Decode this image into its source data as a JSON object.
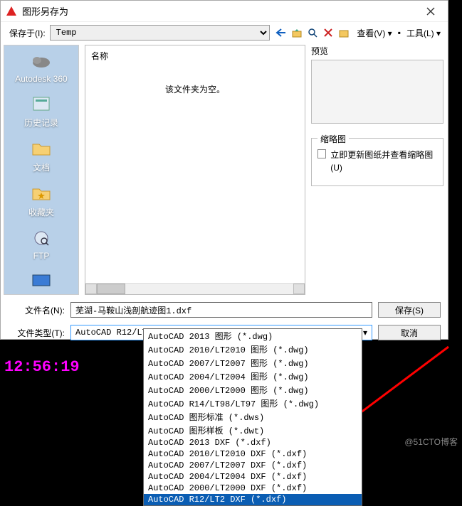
{
  "dialog": {
    "title": "图形另存为"
  },
  "toolbar": {
    "save_in_label": "保存于(I):",
    "folder": "Temp",
    "view_menu": "查看(V)",
    "tools_menu": "工具(L)",
    "separator": "▾",
    "dot": "▪"
  },
  "sidebar": {
    "items": [
      {
        "label": "Autodesk 360"
      },
      {
        "label": "历史记录"
      },
      {
        "label": "文档"
      },
      {
        "label": "收藏夹"
      },
      {
        "label": "FTP"
      },
      {
        "label": "桌面"
      }
    ]
  },
  "file_list": {
    "header": "名称",
    "empty_text": "该文件夹为空。"
  },
  "preview": {
    "label": "预览"
  },
  "thumbnail": {
    "group_label": "缩略图",
    "checkbox_label": "立即更新图纸并查看缩略图(U)"
  },
  "form": {
    "filename_label": "文件名(N):",
    "filename_value": "芜湖-马鞍山浅剖航迹图1.dxf",
    "filetype_label": "文件类型(T):",
    "filetype_value": "AutoCAD R12/LT2 DXF (*.dxf)",
    "save_button": "保存(S)",
    "cancel_button": "取消"
  },
  "dropdown": {
    "items": [
      "AutoCAD 2013 图形 (*.dwg)",
      "AutoCAD 2010/LT2010 图形 (*.dwg)",
      "AutoCAD 2007/LT2007 图形 (*.dwg)",
      "AutoCAD 2004/LT2004 图形 (*.dwg)",
      "AutoCAD 2000/LT2000 图形 (*.dwg)",
      "AutoCAD R14/LT98/LT97 图形 (*.dwg)",
      "AutoCAD 图形标准 (*.dws)",
      "AutoCAD 图形样板 (*.dwt)",
      "AutoCAD 2013 DXF (*.dxf)",
      "AutoCAD 2010/LT2010 DXF (*.dxf)",
      "AutoCAD 2007/LT2007 DXF (*.dxf)",
      "AutoCAD 2004/LT2004 DXF (*.dxf)",
      "AutoCAD 2000/LT2000 DXF (*.dxf)",
      "AutoCAD R12/LT2 DXF (*.dxf)"
    ],
    "selected_index": 13
  },
  "timestamp": "12:56:19",
  "watermark": "@51CTO博客"
}
